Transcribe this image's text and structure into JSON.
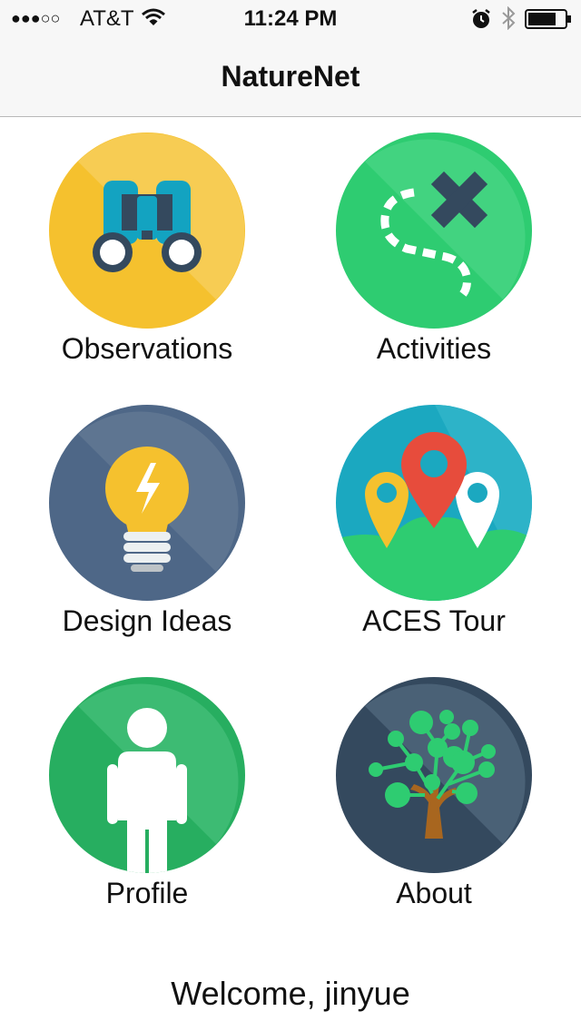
{
  "status_bar": {
    "signal": "●●●○○",
    "carrier": "AT&T",
    "time": "11:24 PM"
  },
  "nav": {
    "title": "NatureNet"
  },
  "menu": [
    {
      "label": "Observations",
      "icon": "binoculars-icon",
      "color": "#F5C12E"
    },
    {
      "label": "Activities",
      "icon": "treasure-map-icon",
      "color": "#2ECC71"
    },
    {
      "label": "Design Ideas",
      "icon": "lightbulb-icon",
      "color": "#4E6787"
    },
    {
      "label": "ACES Tour",
      "icon": "map-pins-icon",
      "color": "#1BA8C0"
    },
    {
      "label": "Profile",
      "icon": "person-icon",
      "color": "#27AE60"
    },
    {
      "label": "About",
      "icon": "tree-icon",
      "color": "#34495E"
    }
  ],
  "welcome": "Welcome, jinyue"
}
